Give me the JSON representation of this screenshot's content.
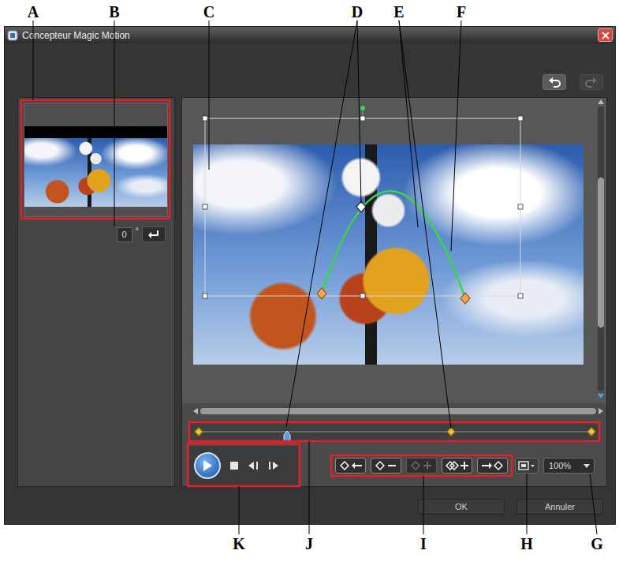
{
  "window": {
    "title": "Concepteur Magic Motion"
  },
  "callouts": [
    {
      "label": "A"
    },
    {
      "label": "B"
    },
    {
      "label": "C"
    },
    {
      "label": "D"
    },
    {
      "label": "E"
    },
    {
      "label": "F"
    },
    {
      "label": "G"
    },
    {
      "label": "H"
    },
    {
      "label": "I"
    },
    {
      "label": "J"
    },
    {
      "label": "K"
    }
  ],
  "toolbar": {
    "undo": {
      "disabled": false
    },
    "redo": {
      "disabled": true
    }
  },
  "rotation": {
    "value": "0",
    "unit": "°"
  },
  "path_points": [
    {
      "current": false
    },
    {
      "current": true
    },
    {
      "current": false
    }
  ],
  "timeline": {
    "playhead": {
      "level": 0.224
    },
    "keyframes": [
      {
        "level": 0
      },
      {
        "level": 0.643
      },
      {
        "level": 1
      }
    ]
  },
  "keyframe_buttons": [
    {
      "kind": "previous",
      "disabled": false
    },
    {
      "kind": "remove",
      "disabled": false
    },
    {
      "kind": "add",
      "disabled": true
    },
    {
      "kind": "duplicate",
      "disabled": false
    },
    {
      "kind": "next",
      "disabled": false
    }
  ],
  "zoom": {
    "value": "100%"
  },
  "buttons": [
    {
      "label": "OK"
    },
    {
      "label": "Annuler"
    }
  ]
}
